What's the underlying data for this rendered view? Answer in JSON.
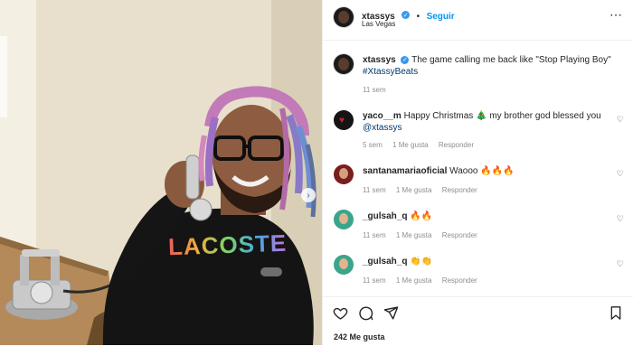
{
  "author": {
    "username": "xtassys",
    "follow_label": "Seguir",
    "location": "Las Vegas"
  },
  "caption": {
    "username": "xtassys",
    "text": "The game calling me back like \"Stop Playing Boy\"",
    "hashtag": "#XtassyBeats",
    "time": "11 sem"
  },
  "comments": [
    {
      "username": "yaco__m",
      "text_a": "Happy Christmas 🎄 my brother god blessed you",
      "mention": "@xtassys",
      "time": "5 sem",
      "likes": "1 Me gusta",
      "reply": "Responder",
      "avatar_color": "#1a1a1a"
    },
    {
      "username": "santanamariaoficial",
      "text_a": "Waooo 🔥🔥🔥",
      "time": "11 sem",
      "likes": "1 Me gusta",
      "reply": "Responder",
      "avatar_color": "#7a1d1d"
    },
    {
      "username": "_gulsah_q",
      "text_a": "🔥🔥",
      "time": "11 sem",
      "likes": "1 Me gusta",
      "reply": "Responder",
      "avatar_color": "#3aa58a"
    },
    {
      "username": "_gulsah_q",
      "text_a": "👏👏",
      "time": "11 sem",
      "likes": "1 Me gusta",
      "reply": "Responder",
      "avatar_color": "#3aa58a"
    }
  ],
  "likes_count": "242 Me gusta",
  "photo": {
    "shirt_brand": "LACOSTE"
  },
  "icons": [
    "heart-icon",
    "comment-icon",
    "share-icon",
    "bookmark-icon",
    "more-icon",
    "verified-icon"
  ]
}
